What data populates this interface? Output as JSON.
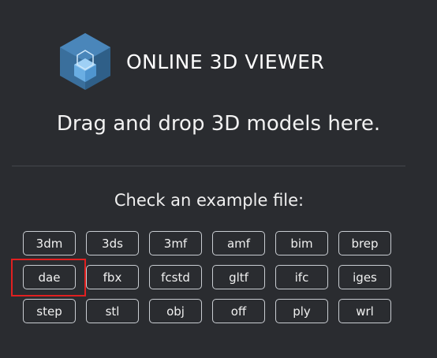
{
  "app": {
    "title": "ONLINE 3D VIEWER",
    "logo_icon": "cube-logo-icon",
    "colors": {
      "background": "#2a2c30",
      "logo_dark": "#3a6f9c",
      "logo_light": "#6aaee3",
      "highlight": "#e02020"
    }
  },
  "main": {
    "drop_text": "Drag and drop 3D models here.",
    "examples_title": "Check an example file:"
  },
  "examples": [
    {
      "label": "3dm"
    },
    {
      "label": "3ds"
    },
    {
      "label": "3mf"
    },
    {
      "label": "amf"
    },
    {
      "label": "bim"
    },
    {
      "label": "brep"
    },
    {
      "label": "dae"
    },
    {
      "label": "fbx"
    },
    {
      "label": "fcstd"
    },
    {
      "label": "gltf"
    },
    {
      "label": "ifc"
    },
    {
      "label": "iges"
    },
    {
      "label": "step"
    },
    {
      "label": "stl"
    },
    {
      "label": "obj"
    },
    {
      "label": "off"
    },
    {
      "label": "ply"
    },
    {
      "label": "wrl"
    }
  ]
}
